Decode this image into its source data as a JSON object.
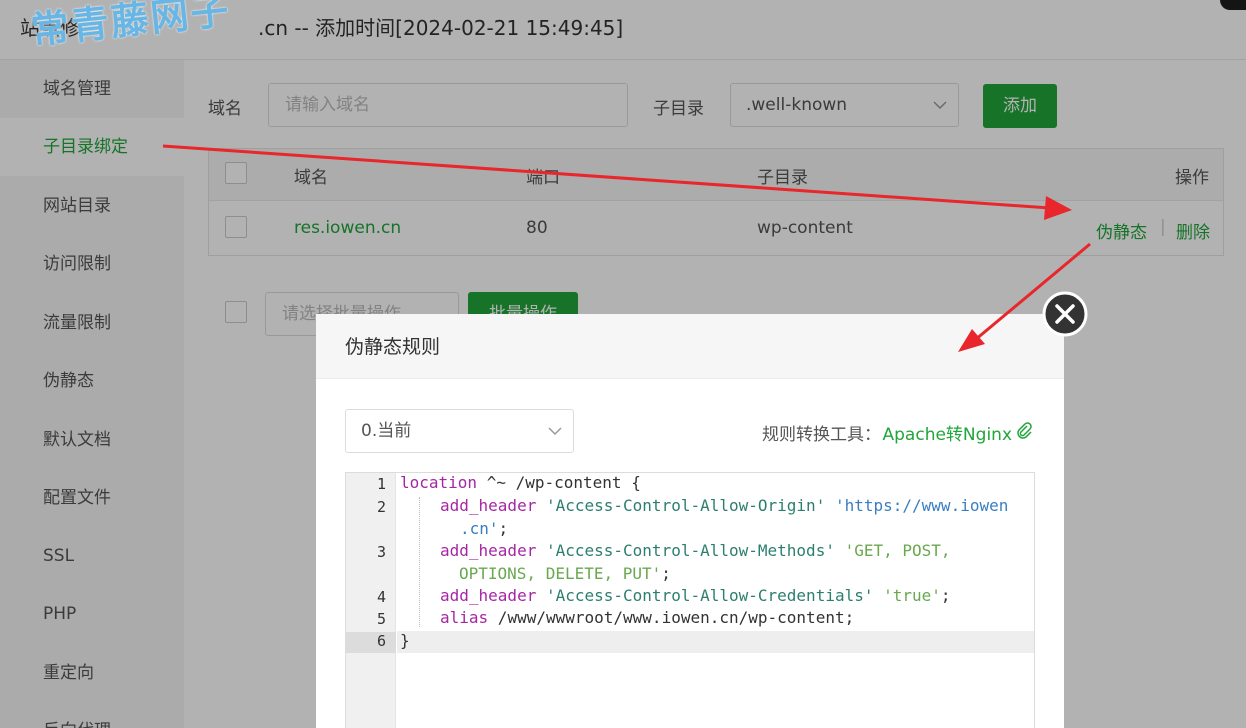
{
  "header": {
    "title_prefix": "站点修",
    "title_suffix": ".cn -- 添加时间[2024-02-21 15:49:45]",
    "watermark": "常青藤网子"
  },
  "sidebar": {
    "items": [
      {
        "label": "域名管理"
      },
      {
        "label": "子目录绑定",
        "active": true
      },
      {
        "label": "网站目录"
      },
      {
        "label": "访问限制"
      },
      {
        "label": "流量限制"
      },
      {
        "label": "伪静态"
      },
      {
        "label": "默认文档"
      },
      {
        "label": "配置文件"
      },
      {
        "label": "SSL"
      },
      {
        "label": "PHP"
      },
      {
        "label": "重定向"
      },
      {
        "label": "反向代理"
      }
    ]
  },
  "form": {
    "domain_label": "域名",
    "domain_placeholder": "请输入域名",
    "subdir_label": "子目录",
    "subdir_value": ".well-known",
    "add_label": "添加"
  },
  "table": {
    "headers": [
      "域名",
      "端口",
      "子目录",
      "操作"
    ],
    "rows": [
      {
        "domain": "res.iowen.cn",
        "port": "80",
        "subdir": "wp-content",
        "op_rewrite": "伪静态",
        "op_sep": "|",
        "op_delete": "删除"
      }
    ]
  },
  "batch": {
    "select_placeholder": "请选择批量操作",
    "button_label": "批量操作"
  },
  "modal": {
    "title": "伪静态规则",
    "version_select": "0.当前",
    "tool_label": "规则转换工具：",
    "tool_link": "Apache转Nginx",
    "line_numbers": [
      "1",
      "2",
      "3",
      "4",
      "5",
      "6"
    ],
    "code": {
      "l1_kw": "location",
      "l1_rest": " ^~ /wp-content {",
      "l2_kw": "add_header",
      "l2_s1": "'Access-Control-Allow-Origin'",
      "l2_s2a": "'https://www.iowen",
      "l2_s2b": ".cn'",
      "l2_end": ";",
      "l3_kw": "add_header",
      "l3_s1": "'Access-Control-Allow-Methods'",
      "l3_s2a": "'GET, POST,",
      "l3_s2b": "OPTIONS, DELETE, PUT'",
      "l3_end": ";",
      "l4_kw": "add_header",
      "l4_s1": "'Access-Control-Allow-Credentials'",
      "l4_s2": "'true'",
      "l4_end": ";",
      "l5_kw": "alias",
      "l5_rest": " /www/wwwroot/www.iowen.cn/wp-content;",
      "l6": "}"
    }
  },
  "colors": {
    "accent": "#20a53a",
    "annotation_arrow": "#e8262b",
    "watermark": "#67b6e6"
  }
}
